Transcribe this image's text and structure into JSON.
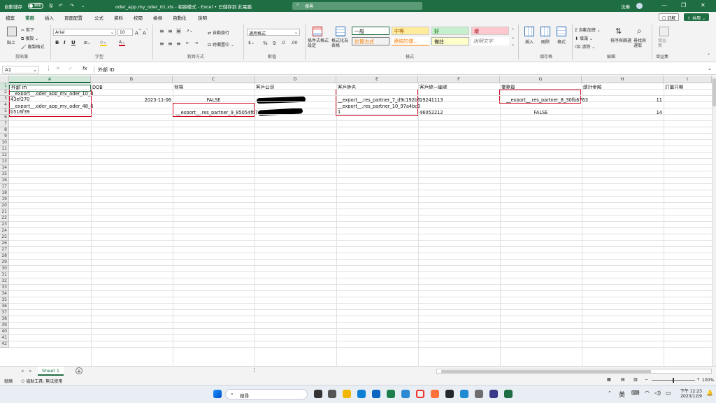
{
  "titlebar": {
    "autosave": "自動儲存",
    "autosave_state": "關閉",
    "filename": "oder_app.my_oder_01.xls - 相容模式 - Excel • 已儲存到 此電腦",
    "search": "搜尋",
    "user": "沈琳"
  },
  "tabs": [
    "檔案",
    "常用",
    "插入",
    "頁面配置",
    "公式",
    "資料",
    "校閱",
    "檢視",
    "自動化",
    "說明"
  ],
  "active_tab": "常用",
  "top_buttons": {
    "comments": "註解",
    "share": "共用"
  },
  "ribbon": {
    "clipboard": {
      "paste": "貼上",
      "cut": "剪下",
      "copy": "複製",
      "format_painter": "複製格式",
      "group": "剪貼簿"
    },
    "font": {
      "name": "Arial",
      "size": "10",
      "group": "字型",
      "bold": "B",
      "italic": "I",
      "underline": "U",
      "grow": "A^",
      "shrink": "Aˇ"
    },
    "alignment": {
      "wrap": "自動換行",
      "merge": "跨欄置中",
      "group": "對齊方式"
    },
    "number": {
      "format": "通用格式",
      "percent": "%",
      "comma": "9",
      "group": "數值"
    },
    "styles": {
      "conditional": "條件式格式設定",
      "table": "格式化為表格",
      "normal": "一般",
      "neutral": "中等",
      "good": "好",
      "bad": "壞",
      "calc": "計算方式",
      "linked": "連結的儲...",
      "note": "備註",
      "explanatory": "說明文字",
      "group": "樣式"
    },
    "cells": {
      "insert": "插入",
      "delete": "刪除",
      "format": "格式",
      "group": "儲存格"
    },
    "editing": {
      "autosum": "自動加總",
      "fill": "填滿",
      "clear": "清除",
      "sort": "排序與篩選",
      "find": "尋找與選取",
      "group": "編輯"
    },
    "addins": {
      "addins": "增益集",
      "group": "增益集"
    }
  },
  "formula_bar": {
    "name_box": "A1",
    "fx": "fx",
    "content": "外部 ID"
  },
  "columns": [
    "A",
    "B",
    "C",
    "D",
    "E",
    "F",
    "G",
    "H",
    "I"
  ],
  "row_numbers": [
    1,
    2,
    3,
    4,
    5,
    6,
    7,
    8,
    9,
    10,
    11,
    12,
    13,
    14,
    15,
    16,
    17,
    18,
    19,
    20,
    21,
    22,
    23,
    24,
    25,
    26,
    27,
    28,
    29,
    30,
    31,
    32,
    33,
    34,
    35,
    36,
    37,
    38,
    39,
    40,
    41,
    42
  ],
  "header_row": [
    "外部 ID",
    "DOB",
    "到場",
    "客戶公司",
    "客戶姓名",
    "客戶統一編號",
    "業務員",
    "總計金額",
    "訂單日期"
  ],
  "rows": [
    {
      "A": "__export__.oder_app_my_oder_10_d\n43ef270",
      "B": "2023-11-06",
      "C": "FALSE",
      "D": "",
      "E": "__export__.res_partner_7_d9c192b5",
      "F": "19241113",
      "G": "__export__.res_partner_8_30fb6763",
      "H": "11",
      "I": ""
    },
    {
      "A": "__export__.oder_app_my_oder_48_6\nb516f39",
      "B": "",
      "C": "__export__.res_partner_9_85054fb7",
      "D": "",
      "E": "__export__.res_partner_10_97a4bc3\n1",
      "F": "46052212",
      "G": "FALSE",
      "H": "14",
      "I": ""
    }
  ],
  "sheet_tabs": [
    "Sheet 1"
  ],
  "status": {
    "ready": "就緒",
    "accessibility": "協助工具: 無法使用",
    "zoom": "100%"
  },
  "taskbar": {
    "search": "搜尋",
    "ime": "英",
    "time": "下午 12:23",
    "date": "2023/12/9"
  }
}
